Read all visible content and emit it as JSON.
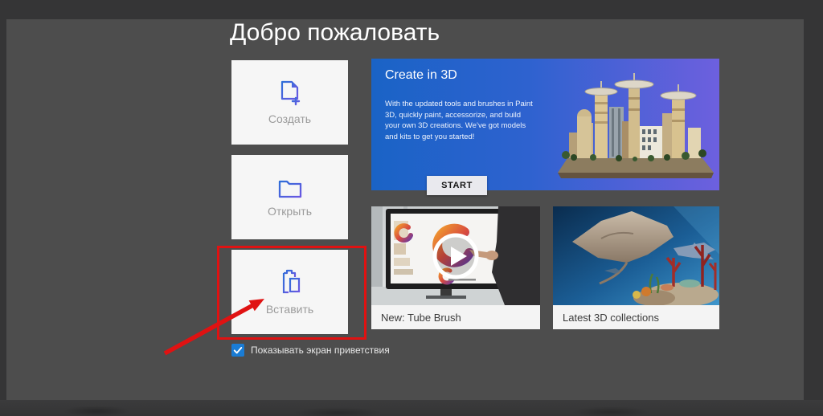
{
  "page_title": "Добро пожаловать",
  "actions": {
    "items": [
      {
        "label": "Создать",
        "icon": "new-document-icon"
      },
      {
        "label": "Открыть",
        "icon": "open-folder-icon"
      },
      {
        "label": "Вставить",
        "icon": "paste-clipboard-icon"
      }
    ]
  },
  "banner": {
    "title": "Create in 3D",
    "description": "With the updated tools and brushes in Paint 3D, quickly paint, accessorize, and build your own 3D creations. We’ve got models and kits to get you started!",
    "start_label": "START",
    "illustration": "3d-city-model",
    "gradient_left": "#1a63c6",
    "gradient_right": "#6d60de"
  },
  "cards": [
    {
      "caption": "New: Tube Brush",
      "thumbnail": "video-with-play-overlay"
    },
    {
      "caption": "Latest 3D collections",
      "thumbnail": "underwater-3d-scene"
    }
  ],
  "welcome_checkbox": {
    "label": "Показывать экран приветствия",
    "checked": true,
    "accent_color": "#1a7cd4"
  },
  "annotation": {
    "shape": "rectangle-and-arrow",
    "color": "#e01212",
    "target": "Вставить"
  },
  "colors": {
    "outer_background": "#353536",
    "window_background": "#4d4d4d",
    "card_background": "#f6f6f6",
    "icon_gradient_start": "#2f6fd8",
    "icon_gradient_end": "#6b57e2"
  }
}
